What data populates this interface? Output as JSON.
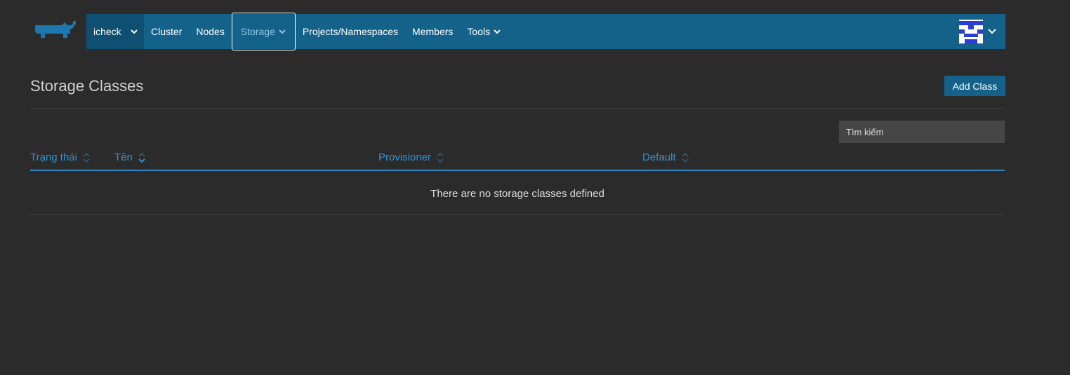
{
  "nav": {
    "cluster": "icheck",
    "items": [
      {
        "label": "Cluster"
      },
      {
        "label": "Nodes"
      },
      {
        "label": "Storage"
      },
      {
        "label": "Projects/Namespaces"
      },
      {
        "label": "Members"
      },
      {
        "label": "Tools"
      }
    ]
  },
  "page": {
    "title": "Storage Classes",
    "add_button": "Add Class"
  },
  "search": {
    "placeholder": "Tìm kiếm"
  },
  "table": {
    "columns": [
      {
        "label": "Trạng thái"
      },
      {
        "label": "Tên"
      },
      {
        "label": "Provisioner"
      },
      {
        "label": "Default"
      }
    ],
    "empty_message": "There are no storage classes defined"
  },
  "colors": {
    "nav_bg": "#14618a",
    "accent": "#2f92d4",
    "page_bg": "#2b2b2b"
  },
  "icons": {
    "logo": "rancher-cow-logo",
    "dropdown": "chevron-down-icon",
    "sort": "sort-icon",
    "avatar": "identicon-avatar"
  }
}
